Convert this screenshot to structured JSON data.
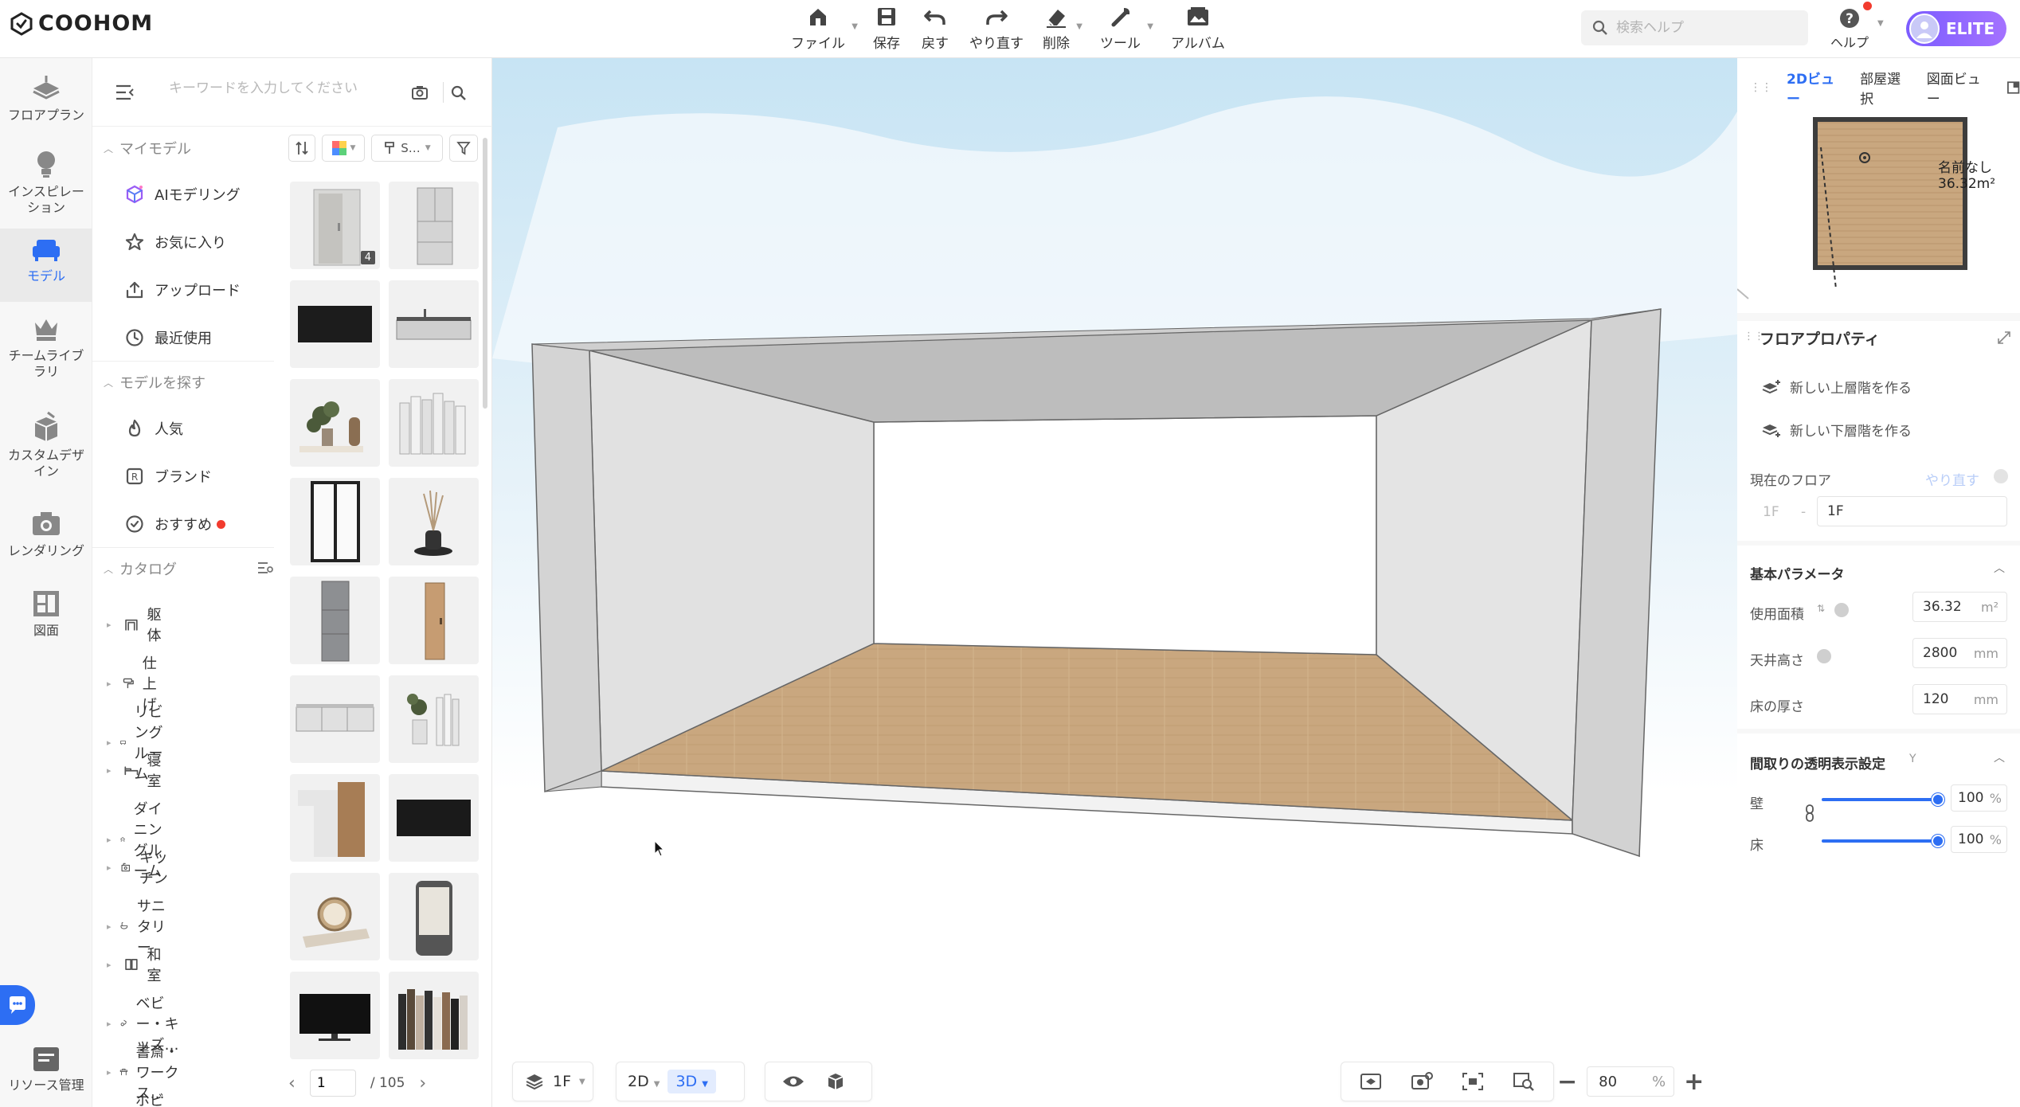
{
  "app": {
    "logo": "COOHOM"
  },
  "toolbar": {
    "items": [
      {
        "label": "ファイル",
        "icon": "file-home-icon"
      },
      {
        "label": "保存",
        "icon": "save-icon"
      },
      {
        "label": "戻す",
        "icon": "undo-icon"
      },
      {
        "label": "やり直す",
        "icon": "redo-icon"
      },
      {
        "label": "削除",
        "icon": "eraser-icon"
      },
      {
        "label": "ツール",
        "icon": "wrench-icon"
      },
      {
        "label": "アルバム",
        "icon": "album-icon"
      }
    ]
  },
  "header": {
    "search_placeholder": "検索ヘルプ",
    "help_label": "ヘルプ",
    "badge": "ELITE"
  },
  "rail": {
    "items": [
      {
        "label": "フロアプラン",
        "icon": "floorplan-icon"
      },
      {
        "label": "インスピレー ション",
        "icon": "bulb-icon"
      },
      {
        "label": "モデル",
        "icon": "sofa-icon"
      },
      {
        "label": "チームライブ ラリ",
        "icon": "crown-icon"
      },
      {
        "label": "カスタムデザ イン",
        "icon": "custom-design-icon"
      },
      {
        "label": "レンダリング",
        "icon": "camera-icon"
      },
      {
        "label": "図面",
        "icon": "drawing-icon"
      }
    ],
    "resource": "リソース管理"
  },
  "library": {
    "search_placeholder": "キーワードを入力してください",
    "my_models": {
      "title": "マイモデル",
      "items": [
        "AIモデリング",
        "お気に入り",
        "アップロード",
        "最近使用"
      ]
    },
    "find_models": {
      "title": "モデルを探す",
      "items": [
        "人気",
        "ブランド",
        "おすすめ"
      ]
    },
    "catalog": {
      "title": "カタログ",
      "items": [
        "躯体",
        "仕上げ",
        "リビングルーム",
        "寝室",
        "ダイニングルーム",
        "キッチン",
        "サニタリー",
        "和室",
        "ベビー・キッズ…",
        "書斎・ワークス…",
        "ホビールーム"
      ]
    },
    "filters": {
      "style_label": "S…"
    },
    "thumb_badge": "4",
    "pager": {
      "current": "1",
      "total": "/ 105"
    }
  },
  "viewport": {
    "floor": "1F",
    "mode_2d": "2D",
    "mode_3d": "3D",
    "zoom": "80",
    "zoom_unit": "%"
  },
  "minimap": {
    "tabs": [
      "2Dビュー",
      "部屋選択",
      "図面ビュー"
    ],
    "room_name": "名前なし",
    "room_area": "36.32m²"
  },
  "properties": {
    "title": "フロアプロパティ",
    "add_upper": "新しい上層階を作る",
    "add_lower": "新しい下層階を作る",
    "current_floor_label": "現在のフロア",
    "redo_link": "やり直す",
    "floor_prefix": "1F",
    "floor_value": "1F",
    "basic_params": "基本パラメータ",
    "area_label": "使用面積",
    "area_value": "36.32",
    "area_unit": "m²",
    "ceiling_label": "天井高さ",
    "ceiling_value": "2800",
    "ceiling_unit": "mm",
    "floor_thickness_label": "床の厚さ",
    "floor_thickness_value": "120",
    "floor_thickness_unit": "mm",
    "transparency_title": "間取りの透明表示設定",
    "wall_label": "壁",
    "wall_value": "100",
    "floor_label": "床",
    "floor_opacity_value": "100",
    "percent": "%"
  },
  "colors": {
    "accent": "#2d6ef3",
    "elite_start": "#7b5cff",
    "elite_end": "#a472ff",
    "floor_wood": "#c9a77f"
  }
}
